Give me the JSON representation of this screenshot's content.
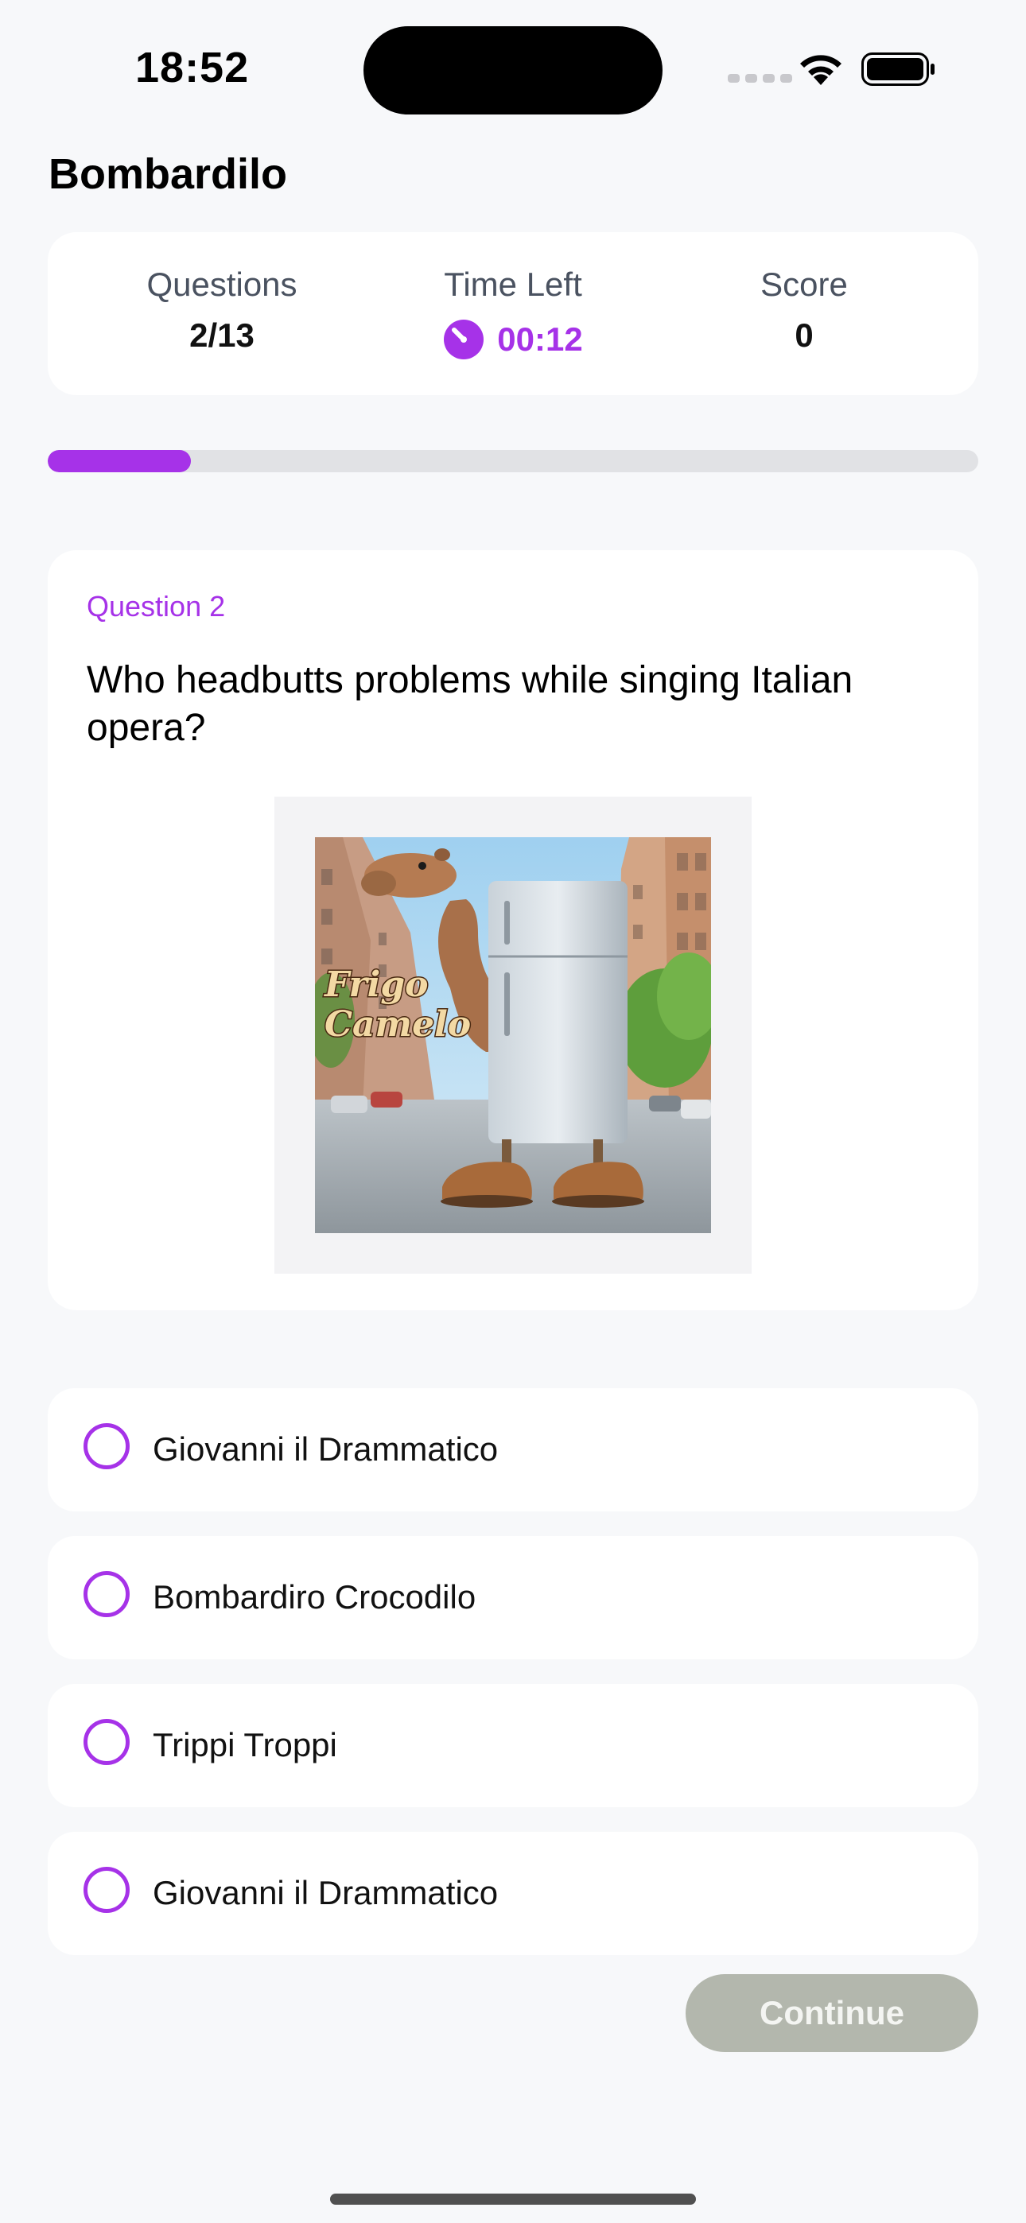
{
  "status_bar": {
    "time": "18:52"
  },
  "app": {
    "title": "Bombardilo"
  },
  "stats": {
    "questions_label": "Questions",
    "questions_value": "2/13",
    "time_label": "Time Left",
    "time_value": "00:12",
    "score_label": "Score",
    "score_value": "0"
  },
  "progress": {
    "fraction": 0.1538
  },
  "question": {
    "number_label": "Question 2",
    "text": "Who headbutts problems while singing Italian opera?",
    "image_caption": "Frigo Camelo"
  },
  "answers": [
    {
      "label": "Giovanni il Drammatico"
    },
    {
      "label": "Bombardiro Crocodilo"
    },
    {
      "label": "Trippi Troppi"
    },
    {
      "label": "Giovanni il Drammatico"
    }
  ],
  "actions": {
    "continue_label": "Continue"
  },
  "colors": {
    "accent": "#a632e8",
    "background": "#f7f8fa",
    "card": "#ffffff",
    "continue_disabled": "#b3b7ad"
  },
  "icons": {
    "timer": "timer-icon",
    "wifi": "wifi-icon",
    "battery": "battery-icon",
    "signal": "cellular-signal-icon"
  }
}
